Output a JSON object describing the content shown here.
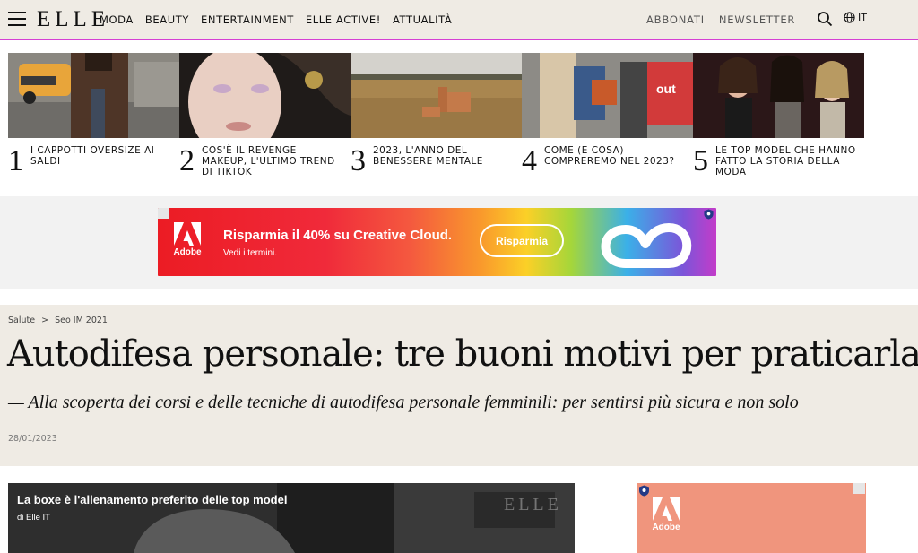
{
  "header": {
    "logo": "ELLE",
    "nav": [
      "MODA",
      "BEAUTY",
      "ENTERTAINMENT",
      "ELLE ACTIVE!",
      "ATTUALITÀ"
    ],
    "subscribe": "ABBONATI",
    "newsletter": "NEWSLETTER",
    "language": "IT"
  },
  "trending": [
    {
      "num": "1",
      "title": "I CAPPOTTI OVERSIZE AI SALDI",
      "icon": "street-style-photo"
    },
    {
      "num": "2",
      "title": "COS'È IL REVENGE MAKEUP, L'ULTIMO TREND DI TIKTOK",
      "icon": "makeup-portrait-photo"
    },
    {
      "num": "3",
      "title": "2023, L'ANNO DEL BENESSERE MENTALE",
      "icon": "field-armchair-photo"
    },
    {
      "num": "4",
      "title": "COME (E COSA) COMPREREMO NEL 2023?",
      "icon": "fashion-crowd-photo"
    },
    {
      "num": "5",
      "title": "LE TOP MODEL CHE HANNO FATTO LA STORIA DELLA MODA",
      "icon": "top-models-photo"
    }
  ],
  "ad": {
    "brand": "Adobe",
    "headline": "Risparmia il 40% su Creative Cloud.",
    "subline": "Vedi i termini.",
    "cta": "Risparmia",
    "colors": {
      "start": "#ec1c24",
      "end": "#c33cc9"
    }
  },
  "article": {
    "breadcrumb": [
      "Salute",
      ">",
      "Seo IM 2021"
    ],
    "headline": "Autodifesa personale: tre buoni motivi per praticarla",
    "subhead": "— Alla scoperta dei corsi e delle tecniche di autodifesa personale femminili: per sentirsi più sicura e non solo",
    "date": "28/01/2023"
  },
  "video": {
    "title": "La boxe è l'allenamento preferito delle top model",
    "byline": "di Elle IT",
    "watermark": "ELLE"
  },
  "side_ad": {
    "brand": "Adobe",
    "color": "#f0957d"
  }
}
